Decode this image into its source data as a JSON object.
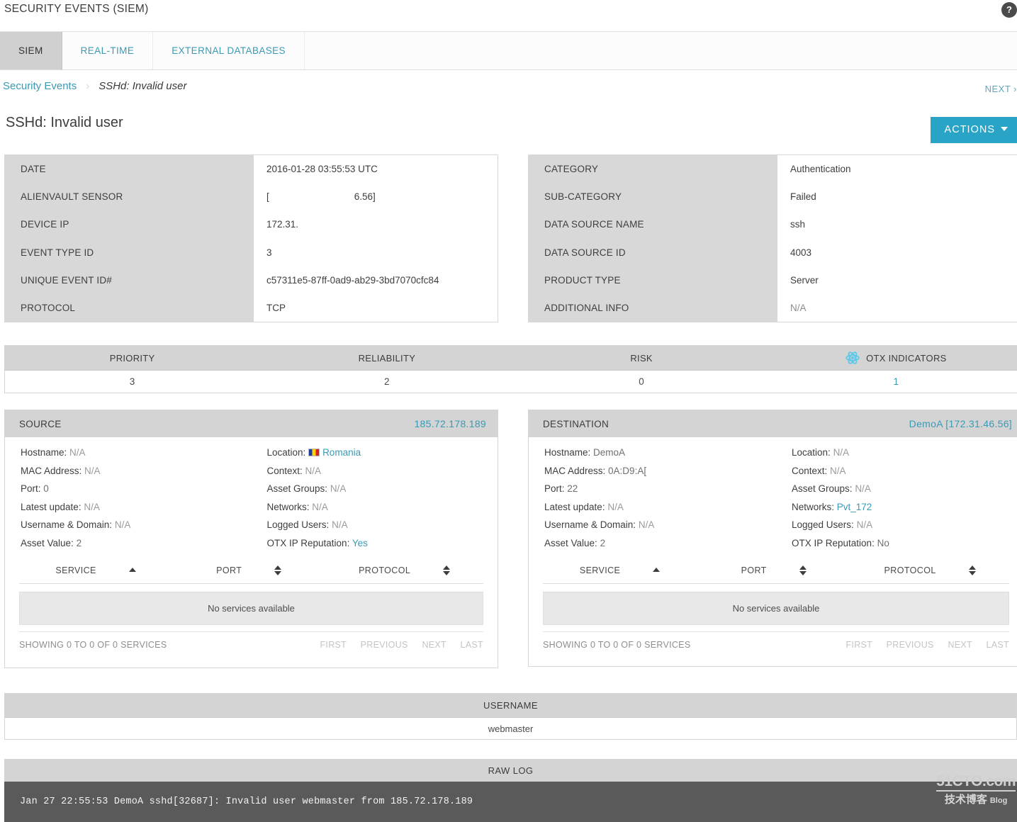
{
  "header": {
    "app_title": "SECURITY EVENTS (SIEM)",
    "help_icon": "question-mark-circle-icon"
  },
  "tabs": [
    {
      "label": "SIEM",
      "active": true
    },
    {
      "label": "REAL-TIME",
      "active": false
    },
    {
      "label": "EXTERNAL DATABASES",
      "active": false
    }
  ],
  "breadcrumb": {
    "root": "Security Events",
    "separator": "›",
    "current": "SSHd: Invalid user"
  },
  "next_link": "NEXT ›",
  "page_title": "SSHd: Invalid user",
  "actions_button": "ACTIONS",
  "event_details_left": [
    {
      "key": "DATE",
      "value": "2016-01-28 03:55:53 UTC"
    },
    {
      "key": "ALIENVAULT SENSOR",
      "value_prefix": "[",
      "value_suffix": "6.56]"
    },
    {
      "key": "DEVICE IP",
      "value": "172.31."
    },
    {
      "key": "EVENT TYPE ID",
      "value": "3"
    },
    {
      "key": "UNIQUE EVENT ID#",
      "value": "c57311e5-87ff-0ad9-ab29-3bd7070cfc84"
    },
    {
      "key": "PROTOCOL",
      "value": "TCP"
    }
  ],
  "event_details_right": [
    {
      "key": "CATEGORY",
      "value": "Authentication",
      "muted": false
    },
    {
      "key": "SUB-CATEGORY",
      "value": "Failed",
      "muted": false
    },
    {
      "key": "DATA SOURCE NAME",
      "value": "ssh",
      "muted": false
    },
    {
      "key": "DATA SOURCE ID",
      "value": "4003",
      "muted": false
    },
    {
      "key": "PRODUCT TYPE",
      "value": "Server",
      "muted": false
    },
    {
      "key": "ADDITIONAL INFO",
      "value": "N/A",
      "muted": true
    }
  ],
  "metrics": {
    "headers": [
      "PRIORITY",
      "RELIABILITY",
      "RISK",
      "OTX INDICATORS"
    ],
    "otx_icon": "otx-atom-icon",
    "values": [
      "3",
      "2",
      "0",
      "1"
    ]
  },
  "source": {
    "panel_title": "SOURCE",
    "ip": "185.72.178.189",
    "left_fields": [
      {
        "label": "Hostname:",
        "value": "N/A",
        "na": true
      },
      {
        "label": "MAC Address:",
        "value": "N/A",
        "na": true
      },
      {
        "label": "Port:",
        "value": "0",
        "na": false
      },
      {
        "label": "Latest update:",
        "value": "N/A",
        "na": true
      },
      {
        "label": "Username & Domain:",
        "value": "N/A",
        "na": true
      },
      {
        "label": "Asset Value:",
        "value": "2",
        "na": false
      }
    ],
    "right_fields": [
      {
        "label": "Location:",
        "value": "Romania",
        "link": true,
        "flag": "romania-flag-icon"
      },
      {
        "label": "Context:",
        "value": "N/A",
        "na": true
      },
      {
        "label": "Asset Groups:",
        "value": "N/A",
        "na": true
      },
      {
        "label": "Networks:",
        "value": "N/A",
        "na": true
      },
      {
        "label": "Logged Users:",
        "value": "N/A",
        "na": true
      },
      {
        "label": "OTX IP Reputation:",
        "value": "Yes",
        "link": true
      }
    ],
    "services": {
      "columns": [
        "SERVICE",
        "PORT",
        "PROTOCOL"
      ],
      "sorts": [
        "asc",
        "both",
        "both"
      ],
      "empty_text": "No services available",
      "showing": "SHOWING 0 TO 0 OF 0 SERVICES",
      "pager": [
        "FIRST",
        "PREVIOUS",
        "NEXT",
        "LAST"
      ]
    }
  },
  "destination": {
    "panel_title": "DESTINATION",
    "ip": "DemoA [172.31.46.56]",
    "left_fields": [
      {
        "label": "Hostname:",
        "value": "DemoA",
        "na": false
      },
      {
        "label": "MAC Address:",
        "value": "0A:D9:A[",
        "na": false
      },
      {
        "label": "Port:",
        "value": "22",
        "na": false
      },
      {
        "label": "Latest update:",
        "value": "N/A",
        "na": true
      },
      {
        "label": "Username & Domain:",
        "value": "N/A",
        "na": true
      },
      {
        "label": "Asset Value:",
        "value": "2",
        "na": false
      }
    ],
    "right_fields": [
      {
        "label": "Location:",
        "value": "N/A",
        "na": true
      },
      {
        "label": "Context:",
        "value": "N/A",
        "na": true
      },
      {
        "label": "Asset Groups:",
        "value": "N/A",
        "na": true
      },
      {
        "label": "Networks:",
        "value": "Pvt_172",
        "link": true
      },
      {
        "label": "Logged Users:",
        "value": "N/A",
        "na": true
      },
      {
        "label": "OTX IP Reputation:",
        "value": "No",
        "na": false
      }
    ],
    "services": {
      "columns": [
        "SERVICE",
        "PORT",
        "PROTOCOL"
      ],
      "sorts": [
        "asc",
        "both",
        "both"
      ],
      "empty_text": "No services available",
      "showing": "SHOWING 0 TO 0 OF 0 SERVICES",
      "pager": [
        "FIRST",
        "PREVIOUS",
        "NEXT",
        "LAST"
      ]
    }
  },
  "username_table": {
    "header": "USERNAME",
    "rows": [
      "webmaster"
    ]
  },
  "raw_log": {
    "header": "RAW LOG",
    "text": "Jan 27 22:55:53 DemoA sshd[32687]: Invalid user webmaster from 185.72.178.189"
  },
  "watermark": {
    "top": "51CTO.com",
    "bottom": "技术博客",
    "blog": "Blog"
  },
  "colors": {
    "accent": "#29a4c6",
    "link": "#3a9ab5",
    "header_gray": "#d4d4d4",
    "raw_log_bg": "#5a5a5a"
  }
}
